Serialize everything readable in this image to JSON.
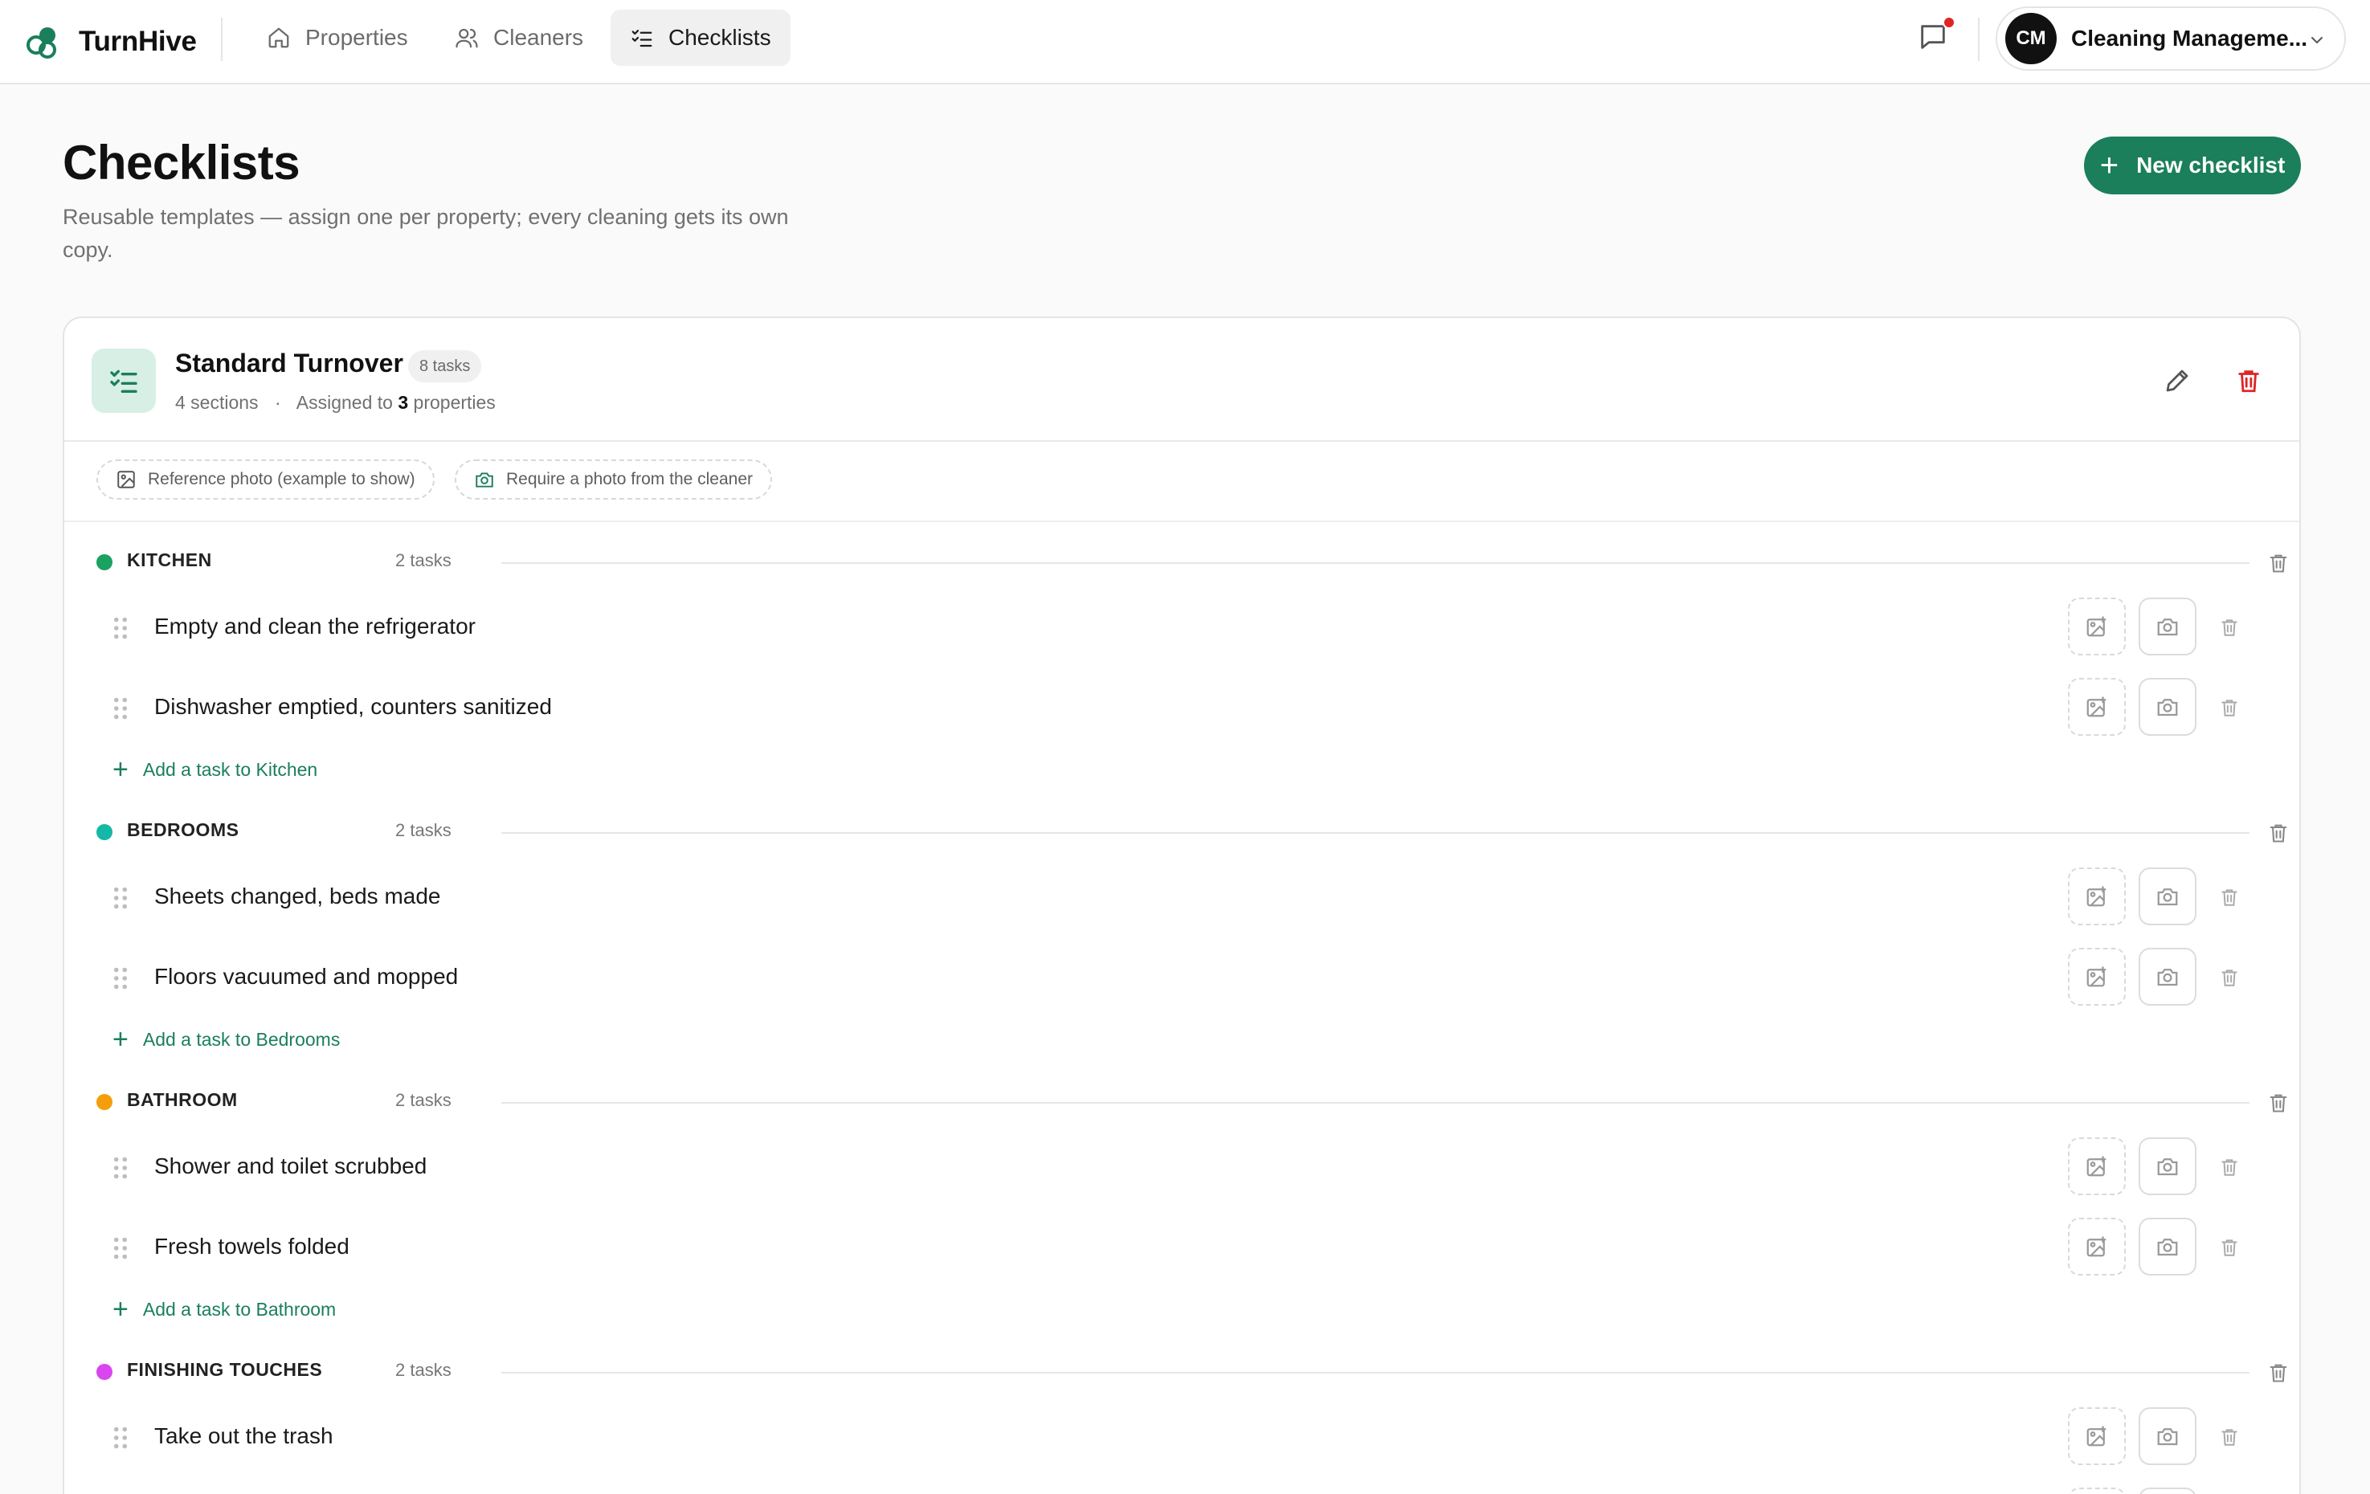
{
  "brand": {
    "name": "TurnHive"
  },
  "nav": {
    "items": [
      {
        "label": "Properties",
        "icon": "home-icon"
      },
      {
        "label": "Cleaners",
        "icon": "users-icon"
      },
      {
        "label": "Checklists",
        "icon": "checklist-icon",
        "active": true
      }
    ]
  },
  "user": {
    "initials": "CM",
    "name": "Cleaning Manageme..."
  },
  "header": {
    "title": "Checklists",
    "subtitle": "Reusable templates — assign one per property; every cleaning gets its own copy.",
    "new_button": "New checklist"
  },
  "checklist": {
    "title": "Standard Turnover",
    "badge": "8 tasks",
    "sections_text": "4 sections",
    "dot": "·",
    "assigned_prefix": "Assigned to",
    "assigned_count": "3",
    "assigned_suffix": "properties"
  },
  "legend": {
    "reference": "Reference photo (example to show)",
    "require": "Require a photo from the cleaner"
  },
  "sections": [
    {
      "name": "KITCHEN",
      "count": "2 tasks",
      "color": "#1aa260",
      "tasks": [
        "Empty and clean the refrigerator",
        "Dishwasher emptied, counters sanitized"
      ],
      "add": "Add a task to Kitchen"
    },
    {
      "name": "BEDROOMS",
      "count": "2 tasks",
      "color": "#14b8a6",
      "tasks": [
        "Sheets changed, beds made",
        "Floors vacuumed and mopped"
      ],
      "add": "Add a task to Bedrooms"
    },
    {
      "name": "BATHROOM",
      "count": "2 tasks",
      "color": "#f59e0b",
      "tasks": [
        "Shower and toilet scrubbed",
        "Fresh towels folded"
      ],
      "add": "Add a task to Bathroom"
    },
    {
      "name": "FINISHING TOUCHES",
      "count": "2 tasks",
      "color": "#d946ef",
      "tasks": [
        "Take out the trash"
      ]
    }
  ],
  "colors": {
    "accent": "#1a7f5a",
    "danger": "#dc2626"
  }
}
